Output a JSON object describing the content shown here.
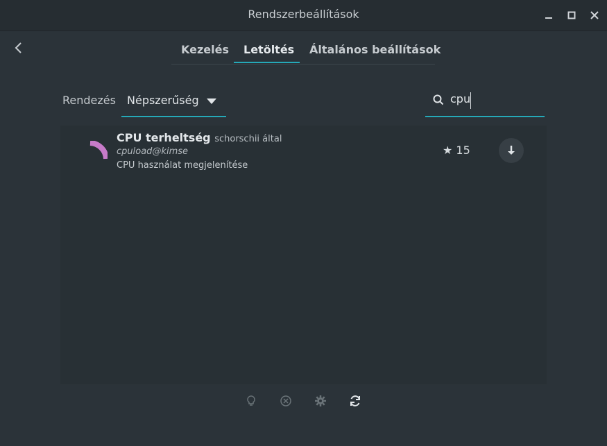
{
  "window": {
    "title": "Rendszerbeállítások"
  },
  "tabs": [
    {
      "label": "Kezelés",
      "active": false
    },
    {
      "label": "Letöltés",
      "active": true
    },
    {
      "label": "Általános beállítások",
      "active": false
    }
  ],
  "toolbar": {
    "sort_label": "Rendezés",
    "sort_value": "Népszerűség",
    "search_value": "cpu"
  },
  "results": [
    {
      "name": "CPU terheltség",
      "author": "schorschii által",
      "uuid": "cpuload@kimse",
      "description": "CPU használat megjelenítése",
      "stars": "★ 15"
    }
  ],
  "bottom_icons": [
    "lightbulb-icon",
    "remove-icon",
    "gear-icon",
    "refresh-icon"
  ],
  "colors": {
    "accent": "#25a9b8",
    "background": "#2b3339",
    "icon_pink": "#c77bc9"
  }
}
